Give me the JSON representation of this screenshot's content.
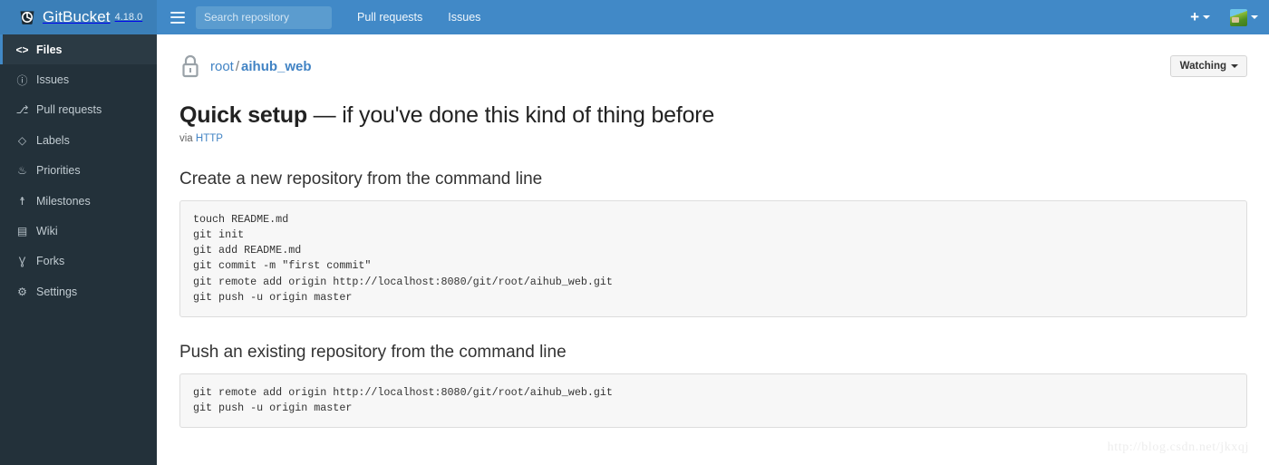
{
  "navbar": {
    "brand": "GitBucket",
    "version": "4.18.0",
    "logo_icon": "gitbucket-bucket-logo-icon",
    "menu_icon": "hamburger-menu-icon",
    "search": {
      "placeholder": "Search repository",
      "value": ""
    },
    "links": [
      {
        "label": "Pull requests",
        "name": "nav-link-pull-requests"
      },
      {
        "label": "Issues",
        "name": "nav-link-issues"
      }
    ],
    "create_menu": {
      "glyph": "+",
      "icon": "plus-icon"
    },
    "avatar": {
      "icon": "user-avatar-icon"
    },
    "colors": {
      "background": "#4189c7",
      "brand_background": "#3b7fb8",
      "search_background": "#5b9ccf"
    }
  },
  "sidebar": {
    "background": "#23313a",
    "active_accent": "#4189c7",
    "items": [
      {
        "label": "Files",
        "icon": "code-brackets-icon",
        "glyph": "<>",
        "active": true
      },
      {
        "label": "Issues",
        "icon": "issue-circle-icon",
        "glyph": "ⓘ",
        "active": false
      },
      {
        "label": "Pull requests",
        "icon": "git-pull-request-icon",
        "glyph": "⎇",
        "active": false
      },
      {
        "label": "Labels",
        "icon": "tag-icon",
        "glyph": "◇",
        "active": false
      },
      {
        "label": "Priorities",
        "icon": "flame-icon",
        "glyph": "♨",
        "active": false
      },
      {
        "label": "Milestones",
        "icon": "milestone-signpost-icon",
        "glyph": "☨",
        "active": false
      },
      {
        "label": "Wiki",
        "icon": "book-icon",
        "glyph": "▤",
        "active": false
      },
      {
        "label": "Forks",
        "icon": "repo-forked-icon",
        "glyph": "Ɣ",
        "active": false
      },
      {
        "label": "Settings",
        "icon": "gear-icon",
        "glyph": "⚙",
        "active": false
      }
    ]
  },
  "repo": {
    "visibility_icon": "lock-icon",
    "owner": "root",
    "separator": "/",
    "name": "aihub_web",
    "watch_button": "Watching"
  },
  "quick_setup": {
    "title_bold": "Quick setup",
    "title_rest": " — if you've done this kind of thing before",
    "via_prefix": "via ",
    "via_protocol": "HTTP"
  },
  "sections": [
    {
      "heading": "Create a new repository from the command line",
      "code": "touch README.md\ngit init\ngit add README.md\ngit commit -m \"first commit\"\ngit remote add origin http://localhost:8080/git/root/aihub_web.git\ngit push -u origin master"
    },
    {
      "heading": "Push an existing repository from the command line",
      "code": "git remote add origin http://localhost:8080/git/root/aihub_web.git\ngit push -u origin master"
    }
  ],
  "watermark": "http://blog.csdn.net/jkxqj"
}
